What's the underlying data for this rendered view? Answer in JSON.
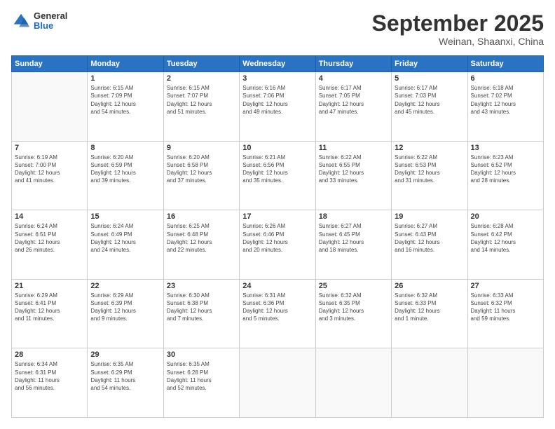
{
  "logo": {
    "general": "General",
    "blue": "Blue"
  },
  "header": {
    "month": "September 2025",
    "location": "Weinan, Shaanxi, China"
  },
  "weekdays": [
    "Sunday",
    "Monday",
    "Tuesday",
    "Wednesday",
    "Thursday",
    "Friday",
    "Saturday"
  ],
  "weeks": [
    [
      {
        "day": "",
        "content": ""
      },
      {
        "day": "1",
        "content": "Sunrise: 6:15 AM\nSunset: 7:09 PM\nDaylight: 12 hours\nand 54 minutes."
      },
      {
        "day": "2",
        "content": "Sunrise: 6:15 AM\nSunset: 7:07 PM\nDaylight: 12 hours\nand 51 minutes."
      },
      {
        "day": "3",
        "content": "Sunrise: 6:16 AM\nSunset: 7:06 PM\nDaylight: 12 hours\nand 49 minutes."
      },
      {
        "day": "4",
        "content": "Sunrise: 6:17 AM\nSunset: 7:05 PM\nDaylight: 12 hours\nand 47 minutes."
      },
      {
        "day": "5",
        "content": "Sunrise: 6:17 AM\nSunset: 7:03 PM\nDaylight: 12 hours\nand 45 minutes."
      },
      {
        "day": "6",
        "content": "Sunrise: 6:18 AM\nSunset: 7:02 PM\nDaylight: 12 hours\nand 43 minutes."
      }
    ],
    [
      {
        "day": "7",
        "content": "Sunrise: 6:19 AM\nSunset: 7:00 PM\nDaylight: 12 hours\nand 41 minutes."
      },
      {
        "day": "8",
        "content": "Sunrise: 6:20 AM\nSunset: 6:59 PM\nDaylight: 12 hours\nand 39 minutes."
      },
      {
        "day": "9",
        "content": "Sunrise: 6:20 AM\nSunset: 6:58 PM\nDaylight: 12 hours\nand 37 minutes."
      },
      {
        "day": "10",
        "content": "Sunrise: 6:21 AM\nSunset: 6:56 PM\nDaylight: 12 hours\nand 35 minutes."
      },
      {
        "day": "11",
        "content": "Sunrise: 6:22 AM\nSunset: 6:55 PM\nDaylight: 12 hours\nand 33 minutes."
      },
      {
        "day": "12",
        "content": "Sunrise: 6:22 AM\nSunset: 6:53 PM\nDaylight: 12 hours\nand 31 minutes."
      },
      {
        "day": "13",
        "content": "Sunrise: 6:23 AM\nSunset: 6:52 PM\nDaylight: 12 hours\nand 28 minutes."
      }
    ],
    [
      {
        "day": "14",
        "content": "Sunrise: 6:24 AM\nSunset: 6:51 PM\nDaylight: 12 hours\nand 26 minutes."
      },
      {
        "day": "15",
        "content": "Sunrise: 6:24 AM\nSunset: 6:49 PM\nDaylight: 12 hours\nand 24 minutes."
      },
      {
        "day": "16",
        "content": "Sunrise: 6:25 AM\nSunset: 6:48 PM\nDaylight: 12 hours\nand 22 minutes."
      },
      {
        "day": "17",
        "content": "Sunrise: 6:26 AM\nSunset: 6:46 PM\nDaylight: 12 hours\nand 20 minutes."
      },
      {
        "day": "18",
        "content": "Sunrise: 6:27 AM\nSunset: 6:45 PM\nDaylight: 12 hours\nand 18 minutes."
      },
      {
        "day": "19",
        "content": "Sunrise: 6:27 AM\nSunset: 6:43 PM\nDaylight: 12 hours\nand 16 minutes."
      },
      {
        "day": "20",
        "content": "Sunrise: 6:28 AM\nSunset: 6:42 PM\nDaylight: 12 hours\nand 14 minutes."
      }
    ],
    [
      {
        "day": "21",
        "content": "Sunrise: 6:29 AM\nSunset: 6:41 PM\nDaylight: 12 hours\nand 11 minutes."
      },
      {
        "day": "22",
        "content": "Sunrise: 6:29 AM\nSunset: 6:39 PM\nDaylight: 12 hours\nand 9 minutes."
      },
      {
        "day": "23",
        "content": "Sunrise: 6:30 AM\nSunset: 6:38 PM\nDaylight: 12 hours\nand 7 minutes."
      },
      {
        "day": "24",
        "content": "Sunrise: 6:31 AM\nSunset: 6:36 PM\nDaylight: 12 hours\nand 5 minutes."
      },
      {
        "day": "25",
        "content": "Sunrise: 6:32 AM\nSunset: 6:35 PM\nDaylight: 12 hours\nand 3 minutes."
      },
      {
        "day": "26",
        "content": "Sunrise: 6:32 AM\nSunset: 6:33 PM\nDaylight: 12 hours\nand 1 minute."
      },
      {
        "day": "27",
        "content": "Sunrise: 6:33 AM\nSunset: 6:32 PM\nDaylight: 11 hours\nand 59 minutes."
      }
    ],
    [
      {
        "day": "28",
        "content": "Sunrise: 6:34 AM\nSunset: 6:31 PM\nDaylight: 11 hours\nand 56 minutes."
      },
      {
        "day": "29",
        "content": "Sunrise: 6:35 AM\nSunset: 6:29 PM\nDaylight: 11 hours\nand 54 minutes."
      },
      {
        "day": "30",
        "content": "Sunrise: 6:35 AM\nSunset: 6:28 PM\nDaylight: 11 hours\nand 52 minutes."
      },
      {
        "day": "",
        "content": ""
      },
      {
        "day": "",
        "content": ""
      },
      {
        "day": "",
        "content": ""
      },
      {
        "day": "",
        "content": ""
      }
    ]
  ]
}
